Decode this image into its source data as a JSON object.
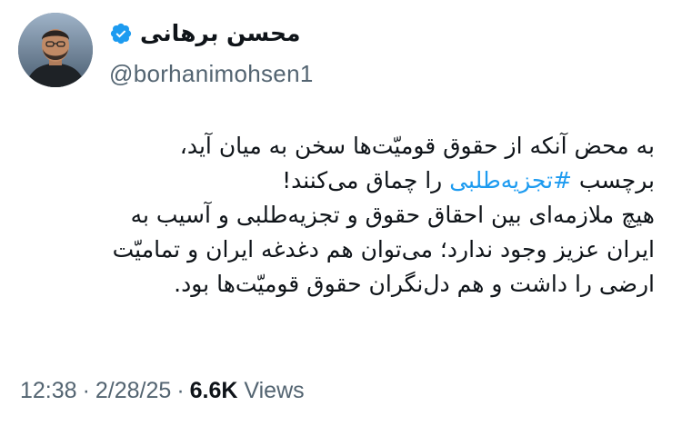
{
  "author": {
    "display_name": "محسن برهانی",
    "handle": "@borhanimohsen1",
    "verified": true,
    "verified_color": "#1d9bf0"
  },
  "tweet": {
    "line1": "به محض آنکه از حقوق قومیّت‌ها سخن به میان آید،",
    "line2_before": "برچسب ",
    "line2_hashtag": "#تجزیه‌طلبی",
    "line2_after": " را چماق می‌کنند!",
    "line3": "هیچ ملازمه‌ای بین احقاق حقوق و تجزیه‌طلبی و آسیب به",
    "line4": "ایران عزیز وجود ندارد؛ می‌توان هم دغدغه ایران و تمامیّت",
    "line5": "ارضی را داشت و هم دل‌نگران حقوق قومیّت‌ها بود.",
    "hashtag_color": "#1d9bf0"
  },
  "meta": {
    "time": "12:38",
    "separator": "·",
    "date": "2/28/25",
    "views_count": "6.6K",
    "views_label": "Views"
  }
}
